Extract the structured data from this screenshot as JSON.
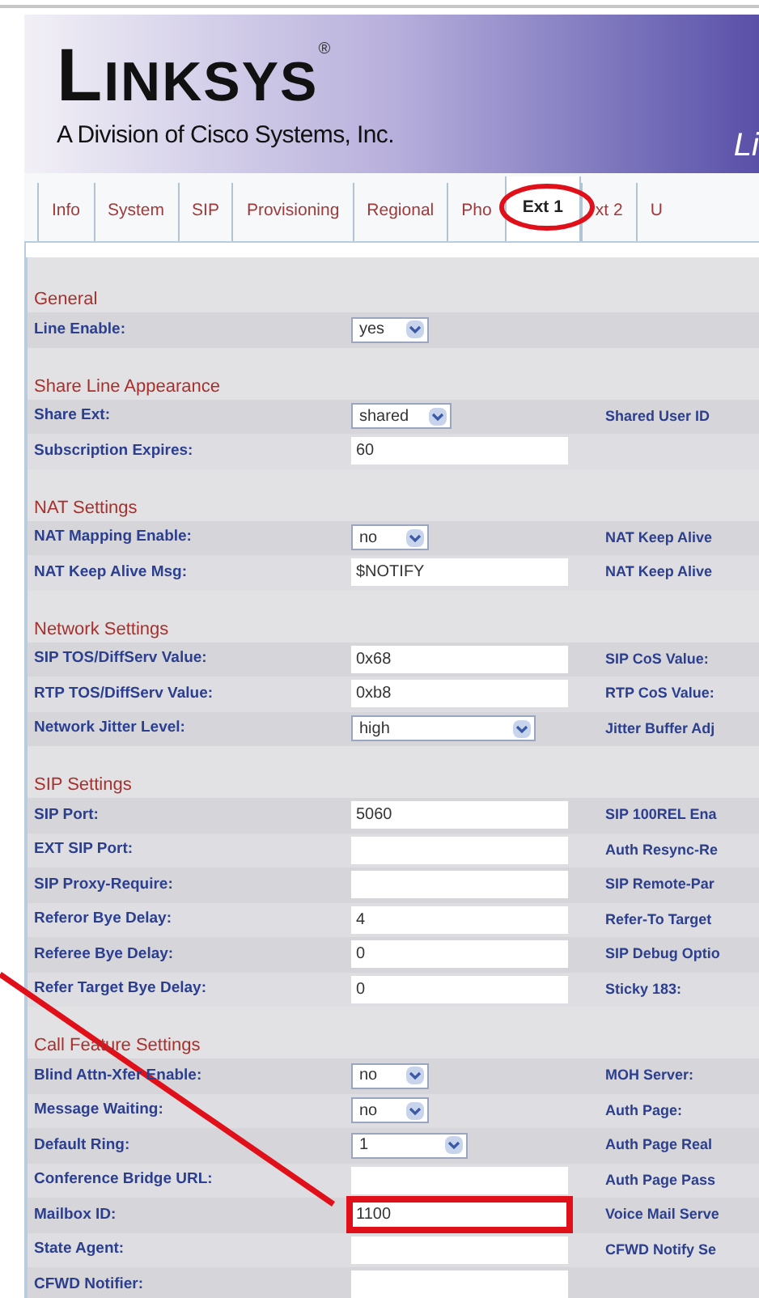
{
  "header": {
    "logo": "LINKSYS",
    "registered": "®",
    "tagline": "A Division of Cisco Systems, Inc.",
    "title": "Li"
  },
  "tabs": [
    {
      "label": "Info",
      "selected": false
    },
    {
      "label": "System",
      "selected": false
    },
    {
      "label": "SIP",
      "selected": false
    },
    {
      "label": "Provisioning",
      "selected": false
    },
    {
      "label": "Regional",
      "selected": false
    },
    {
      "label": "Pho",
      "selected": false
    },
    {
      "label": "Ext 1",
      "selected": true,
      "circled": true
    },
    {
      "label": "xt 2",
      "selected": false
    },
    {
      "label": "U",
      "selected": false
    }
  ],
  "sections": [
    {
      "title": "General",
      "rows": [
        {
          "label": "Line Enable:",
          "kind": "select",
          "value": "yes"
        }
      ]
    },
    {
      "title": "Share Line Appearance",
      "rows": [
        {
          "label": "Share Ext:",
          "kind": "select",
          "value": "shared",
          "right_label": "Shared User ID"
        },
        {
          "label": "Subscription Expires:",
          "kind": "text",
          "value": "60"
        }
      ]
    },
    {
      "title": "NAT Settings",
      "rows": [
        {
          "label": "NAT Mapping Enable:",
          "kind": "select",
          "value": "no",
          "right_label": "NAT Keep Alive"
        },
        {
          "label": "NAT Keep Alive Msg:",
          "kind": "text",
          "value": "$NOTIFY",
          "right_label": "NAT Keep Alive"
        }
      ]
    },
    {
      "title": "Network Settings",
      "rows": [
        {
          "label": "SIP TOS/DiffServ Value:",
          "kind": "text",
          "value": "0x68",
          "right_label": "SIP CoS Value:"
        },
        {
          "label": "RTP TOS/DiffServ Value:",
          "kind": "text",
          "value": "0xb8",
          "right_label": "RTP CoS Value:"
        },
        {
          "label": "Network Jitter Level:",
          "kind": "combo",
          "value": "high",
          "right_label": "Jitter Buffer Adj"
        }
      ]
    },
    {
      "title": "SIP Settings",
      "rows": [
        {
          "label": "SIP Port:",
          "kind": "text",
          "value": "5060",
          "right_label": "SIP 100REL Ena"
        },
        {
          "label": "EXT SIP Port:",
          "kind": "text",
          "right_label": "Auth Resync-Re"
        },
        {
          "label": "SIP Proxy-Require:",
          "kind": "text",
          "right_label": "SIP Remote-Par"
        },
        {
          "label": "Referor Bye Delay:",
          "kind": "text",
          "value": "4",
          "right_label": "Refer-To Target"
        },
        {
          "label": "Referee Bye Delay:",
          "kind": "text",
          "value": "0",
          "right_label": "SIP Debug Optio"
        },
        {
          "label": "Refer Target Bye Delay:",
          "kind": "text",
          "value": "0",
          "right_label": "Sticky 183:"
        }
      ]
    },
    {
      "title": "Call Feature Settings",
      "rows": [
        {
          "label": "Blind Attn-Xfer Enable:",
          "kind": "select",
          "value": "no",
          "right_label": "MOH Server:"
        },
        {
          "label": "Message Waiting:",
          "kind": "select",
          "value": "no",
          "right_label": "Auth Page:"
        },
        {
          "label": "Default Ring:",
          "kind": "ring",
          "value": "1",
          "right_label": "Auth Page Real"
        },
        {
          "label": "Conference Bridge URL:",
          "kind": "text",
          "right_label": "Auth Page Pass"
        },
        {
          "label": "Mailbox ID:",
          "kind": "text",
          "value": "1100",
          "right_label": "Voice Mail Serve",
          "highlighted": true
        },
        {
          "label": "State Agent:",
          "kind": "text",
          "right_label": "CFWD Notify Se"
        },
        {
          "label": "CFWD Notifier:",
          "kind": "text"
        }
      ]
    }
  ],
  "pointer_line": true
}
